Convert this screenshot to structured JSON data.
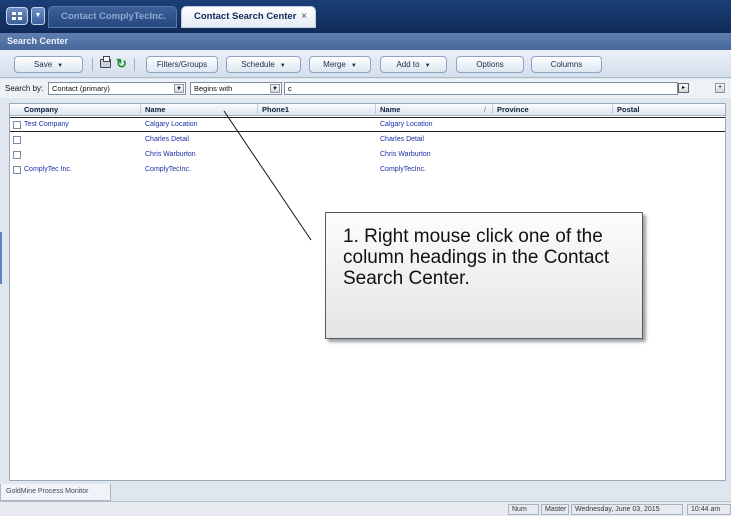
{
  "tabs": [
    {
      "label": "Contact ComplyTecInc."
    },
    {
      "label": "Contact Search Center",
      "close": "×"
    }
  ],
  "panel": {
    "title": "Search Center"
  },
  "toolbar": {
    "save_label": "Save",
    "filters_label": "Filters/Groups",
    "schedule_label": "Schedule",
    "merge_label": "Merge",
    "addto_label": "Add to",
    "options_label": "Options",
    "columns_label": "Columns",
    "dropdown_glyph": "▼"
  },
  "search": {
    "label": "Search by:",
    "field_value": "Contact (primary)",
    "operator_value": "Begins with",
    "input_value": "c",
    "go_glyph": "▸",
    "add_glyph": "+"
  },
  "grid": {
    "columns": [
      "Company",
      "Name",
      "Phone1",
      "Name",
      "Province",
      "Postal"
    ],
    "sort_indicator": "/",
    "rows": [
      {
        "company": "Test Company",
        "name": "Calgary Location",
        "phone": "",
        "name2": "Calgary Location",
        "province": "",
        "postal": ""
      },
      {
        "company": "",
        "name": "Charles Detail",
        "phone": "",
        "name2": "Charles Detail",
        "province": "",
        "postal": ""
      },
      {
        "company": "",
        "name": "Chris Warburton",
        "phone": "",
        "name2": "Chris Warburton",
        "province": "",
        "postal": ""
      },
      {
        "company": "ComplyTec Inc.",
        "name": "ComplyTecInc.",
        "phone": "",
        "name2": "ComplyTecInc.",
        "province": "",
        "postal": ""
      }
    ]
  },
  "callout": {
    "text": "1. Right mouse click one of the column headings in the Contact Search Center."
  },
  "bottom": {
    "process_monitor": "GoldMine Process Monitor"
  },
  "statusbar": {
    "num": "Num",
    "user": "Master",
    "date": "Wednesday, June 03, 2015",
    "time": "10:44 am"
  }
}
